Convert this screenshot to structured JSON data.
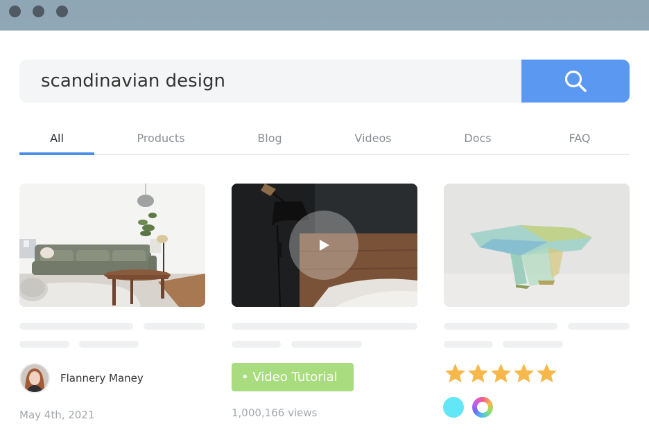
{
  "window": {
    "controls": [
      "close",
      "minimize",
      "maximize"
    ]
  },
  "search": {
    "value": "scandinavian design",
    "button_icon": "search-icon",
    "accent": "#5a98f2"
  },
  "tabs": [
    {
      "label": "All",
      "active": true
    },
    {
      "label": "Products",
      "active": false
    },
    {
      "label": "Blog",
      "active": false
    },
    {
      "label": "Videos",
      "active": false
    },
    {
      "label": "Docs",
      "active": false
    },
    {
      "label": "FAQ",
      "active": false
    }
  ],
  "cards": [
    {
      "image": "living-room-photo",
      "author": "Flannery Maney",
      "date": "May 4th, 2021"
    },
    {
      "image": "bedroom-lamp-video-thumbnail",
      "badge": "• Video Tutorial",
      "badge_color": "#a8dc7e",
      "views": "1,000,166 views"
    },
    {
      "image": "glass-table-photo",
      "rating": 5,
      "rating_max": 5,
      "star_color": "#f6b84b",
      "color_options": [
        "#63e6f5",
        "rainbow-ring"
      ]
    }
  ]
}
